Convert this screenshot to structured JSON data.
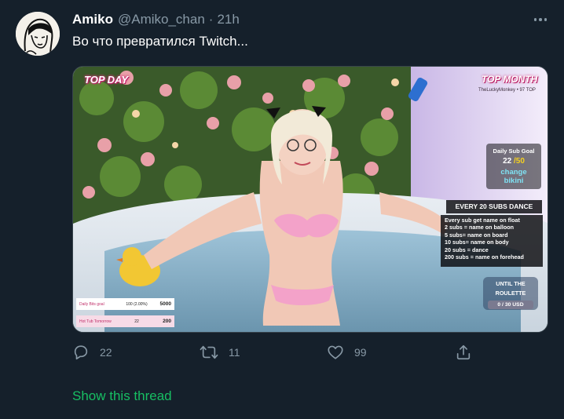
{
  "tweet": {
    "author_name": "Amiko",
    "author_handle": "@Amiko_chan",
    "separator": "·",
    "time": "21h",
    "text": "Во что превратился Twitch..."
  },
  "media_overlay": {
    "top_day": "TOP DAY",
    "top_month": "TOP MONTH",
    "top_month_sub": "TheLuckyMonkey • 97 TOP",
    "daily_goal": {
      "title": "Daily Sub Goal",
      "current": "22",
      "target": "/50",
      "goal_line1": "change",
      "goal_line2": "bikini"
    },
    "banner": "EVERY 20 SUBS DANCE",
    "rules": [
      "Every sub get name on float",
      "2 subs = name on balloon",
      "5  subs= name on board",
      "10 subs= name on body",
      "20 subs = dance",
      "200 subs = name on forehead"
    ],
    "roulette": {
      "title_line1": "UNTIL THE",
      "title_line2": "ROULETTE",
      "progress": "0 / 30 USD"
    },
    "stat_rows": [
      {
        "label": "Daily Bits goal",
        "mid": "100 (2.00%)",
        "value": "5000"
      },
      {
        "label": "Hot Tub Tomorrow",
        "mid": "22",
        "value": "200"
      }
    ]
  },
  "actions": {
    "reply_count": "22",
    "retweet_count": "11",
    "like_count": "99"
  },
  "show_thread": "Show this thread",
  "colors": {
    "background": "#15202b",
    "secondary_text": "#8899a6",
    "thread_link": "#17bf63"
  }
}
